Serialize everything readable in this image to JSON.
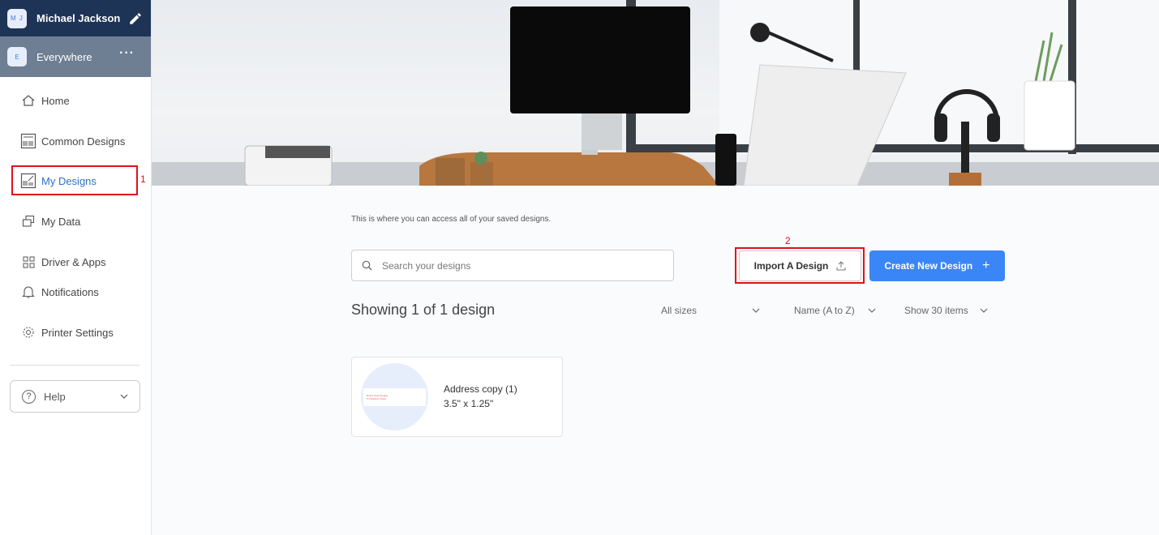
{
  "user": {
    "initials": "M J",
    "name": "Michael Jackson"
  },
  "workspace": {
    "initial": "E",
    "name": "Everywhere",
    "more": "···"
  },
  "nav": {
    "home": "Home",
    "common_designs": "Common Designs",
    "my_designs": "My Designs",
    "my_data": "My Data",
    "driver_apps": "Driver & Apps",
    "notifications": "Notifications",
    "printer_settings": "Printer Settings"
  },
  "help": {
    "label": "Help"
  },
  "annotations": {
    "mark_1": "1",
    "mark_2": "2"
  },
  "main": {
    "intro": "This is where you can access all of your saved designs.",
    "search_placeholder": "Search your designs",
    "import_label": "Import A Design",
    "create_label": "Create New Design",
    "showing": "Showing 1 of 1 design",
    "filters": {
      "size": "All sizes",
      "sort": "Name (A to Z)",
      "per_page": "Show 30 items"
    }
  },
  "designs": [
    {
      "title": "Address copy (1)",
      "size": "3.5\" x 1.25\"",
      "thumb_lines": [
        "Robot Technologies",
        "5 Oneblock Street"
      ]
    }
  ],
  "colors": {
    "accent": "#3b86f7",
    "sidebar_header": "#1e3457",
    "workspace_bar": "#6e7e93",
    "annotation": "#e0101a"
  }
}
